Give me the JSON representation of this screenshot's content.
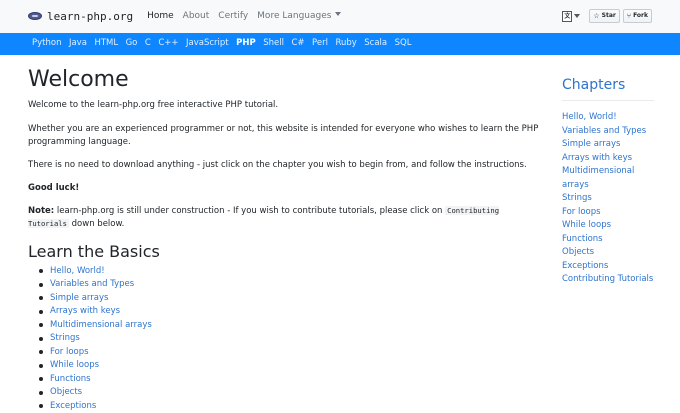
{
  "topnav": {
    "brand": "learn-php.org",
    "links": [
      {
        "label": "Home"
      },
      {
        "label": "About"
      },
      {
        "label": "Certify"
      },
      {
        "label": "More Languages"
      }
    ],
    "github": {
      "star": "Star",
      "fork": "Fork"
    }
  },
  "langbar": {
    "languages": [
      "Python",
      "Java",
      "HTML",
      "Go",
      "C",
      "C++",
      "JavaScript",
      "PHP",
      "Shell",
      "C#",
      "Perl",
      "Ruby",
      "Scala",
      "SQL"
    ],
    "active": "PHP"
  },
  "main": {
    "title": "Welcome",
    "intro": "Welcome to the learn-php.org free interactive PHP tutorial.",
    "para2": "Whether you are an experienced programmer or not, this website is intended for everyone who wishes to learn the PHP programming language.",
    "para3": "There is no need to download anything - just click on the chapter you wish to begin from, and follow the instructions.",
    "good_luck": "Good luck!",
    "note_label": "Note:",
    "note_text": " learn-php.org is still under construction - If you wish to contribute tutorials, please click on ",
    "note_code": "Contributing Tutorials",
    "note_end": " down below.",
    "basics_title": "Learn the Basics",
    "basics": [
      "Hello, World!",
      "Variables and Types",
      "Simple arrays",
      "Arrays with keys",
      "Multidimensional arrays",
      "Strings",
      "For loops",
      "While loops",
      "Functions",
      "Objects",
      "Exceptions"
    ]
  },
  "sidebar": {
    "title": "Chapters",
    "items": [
      "Hello, World!",
      "Variables and Types",
      "Simple arrays",
      "Arrays with keys",
      "Multidimensional arrays",
      "Strings",
      "For loops",
      "While loops",
      "Functions",
      "Objects",
      "Exceptions",
      "Contributing Tutorials"
    ]
  },
  "colors": {
    "accent": "#0d86ff",
    "link": "#2e74ce",
    "nav_bg": "#f8f9fa"
  }
}
